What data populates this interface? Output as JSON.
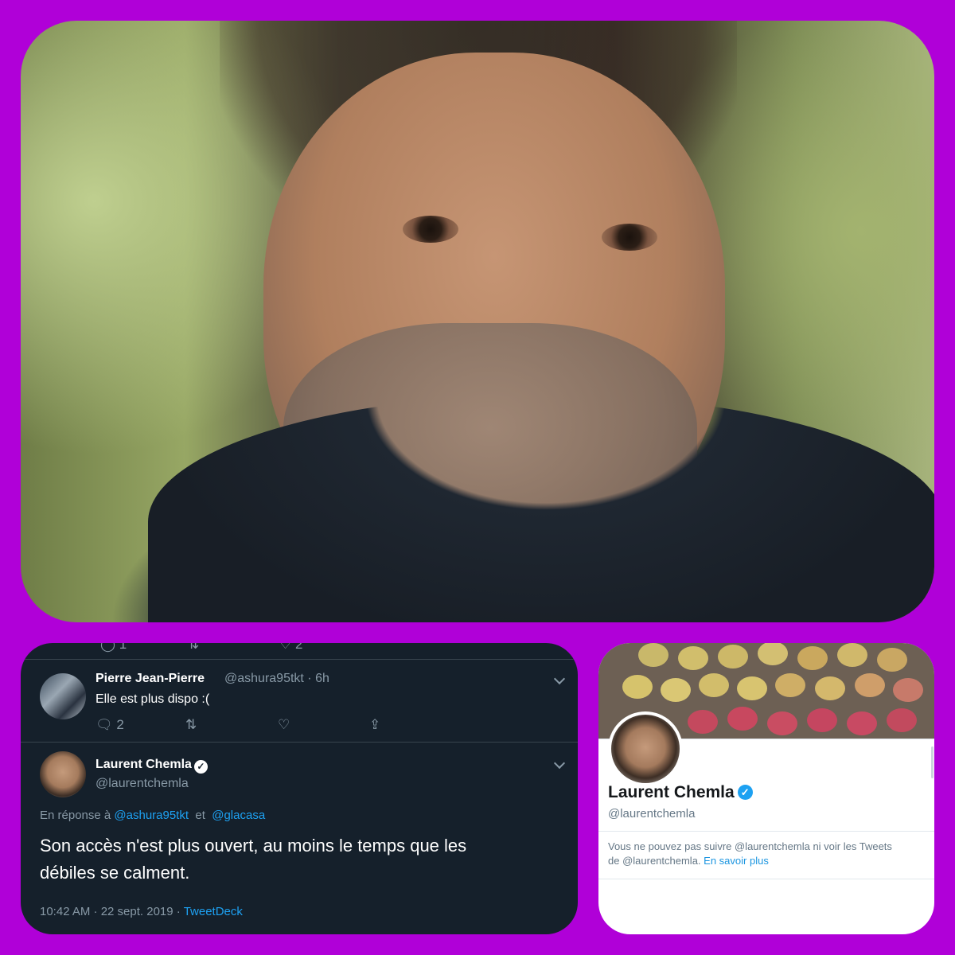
{
  "tweet_card": {
    "top_actions": {
      "replies": "1",
      "likes": "2"
    },
    "reply1": {
      "name": "Pierre Jean-Pierre",
      "handle_time": "@ashura95tkt · 6h",
      "text": "Elle est plus dispo :(",
      "reply_count": "2"
    },
    "main": {
      "name": "Laurent Chemla",
      "handle": "@laurentchemla",
      "reply_prefix": "En réponse à",
      "mention1": "@ashura95tkt",
      "conjunction": "et",
      "mention2": "@glacasa",
      "text_line1": "Son accès n'est plus ouvert, au moins le temps que les",
      "text_line2": "débiles se calment.",
      "timestamp": "10:42 AM · 22 sept. 2019 ·",
      "source": "TweetDeck"
    }
  },
  "profile_card": {
    "name": "Laurent Chemla",
    "handle": "@laurentchemla",
    "notice_line1": "Vous ne pouvez pas suivre @laurentchemla ni voir les Tweets",
    "notice_line2_prefix": "de @laurentchemla.",
    "learn_more": "En savoir plus"
  },
  "colors": {
    "background": "#b000d8",
    "tweet_bg": "#15202b",
    "link": "#1da1f2",
    "muted": "#8899a6"
  },
  "icons": [
    "reply-icon",
    "retweet-icon",
    "like-icon",
    "share-icon",
    "chevron-down-icon",
    "verified-icon"
  ]
}
